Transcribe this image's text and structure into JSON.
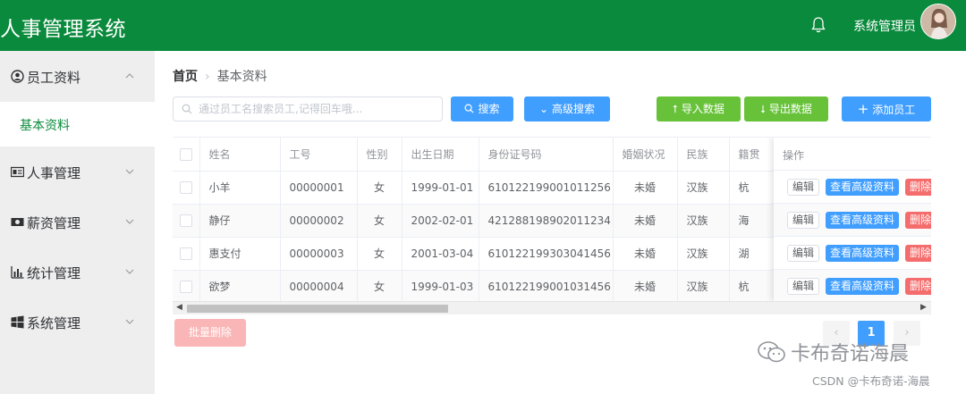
{
  "header": {
    "title": "人事管理系统",
    "user_name": "系统管理员",
    "bg_color": "#0a8a3c"
  },
  "sidebar": {
    "items": [
      {
        "label": "员工资料",
        "icon": "person-circle-icon",
        "expanded": true,
        "children": [
          {
            "label": "基本资料",
            "active": true
          }
        ]
      },
      {
        "label": "人事管理",
        "icon": "id-card-icon",
        "expanded": false
      },
      {
        "label": "薪资管理",
        "icon": "money-icon",
        "expanded": false
      },
      {
        "label": "统计管理",
        "icon": "bar-chart-icon",
        "expanded": false
      },
      {
        "label": "系统管理",
        "icon": "windows-icon",
        "expanded": false
      }
    ]
  },
  "breadcrumb": {
    "home": "首页",
    "current": "基本资料"
  },
  "search": {
    "placeholder": "通过员工名搜索员工,记得回车哦...",
    "value": ""
  },
  "buttons": {
    "search": "搜索",
    "advanced_search": "高级搜索",
    "import": "导入数据",
    "export": "导出数据",
    "add": "添加员工",
    "batch_delete": "批量删除"
  },
  "table": {
    "columns": [
      "姓名",
      "工号",
      "性别",
      "出生日期",
      "身份证号码",
      "婚姻状况",
      "民族",
      "籍贯",
      "操作"
    ],
    "rows": [
      {
        "name": "小羊",
        "work_id": "00000001",
        "gender": "女",
        "birthday": "1999-01-01",
        "id_card": "610122199001011256",
        "marital": "未婚",
        "nation": "汉族",
        "native_place": "杭"
      },
      {
        "name": "静仔",
        "work_id": "00000002",
        "gender": "女",
        "birthday": "2002-02-01",
        "id_card": "421288198902011234",
        "marital": "未婚",
        "nation": "汉族",
        "native_place": "海"
      },
      {
        "name": "惠支付",
        "work_id": "00000003",
        "gender": "女",
        "birthday": "2001-03-04",
        "id_card": "610122199303041456",
        "marital": "未婚",
        "nation": "汉族",
        "native_place": "湖"
      },
      {
        "name": "欲梦",
        "work_id": "00000004",
        "gender": "女",
        "birthday": "1999-01-03",
        "id_card": "610122199001031456",
        "marital": "未婚",
        "nation": "汉族",
        "native_place": "杭"
      }
    ],
    "ops": {
      "edit": "编辑",
      "view": "查看高级资料",
      "delete": "删除"
    }
  },
  "pagination": {
    "current": "1"
  },
  "watermark": {
    "brand": "卡布奇诺海晨",
    "credit": "CSDN @卡布奇诺-海晨"
  }
}
